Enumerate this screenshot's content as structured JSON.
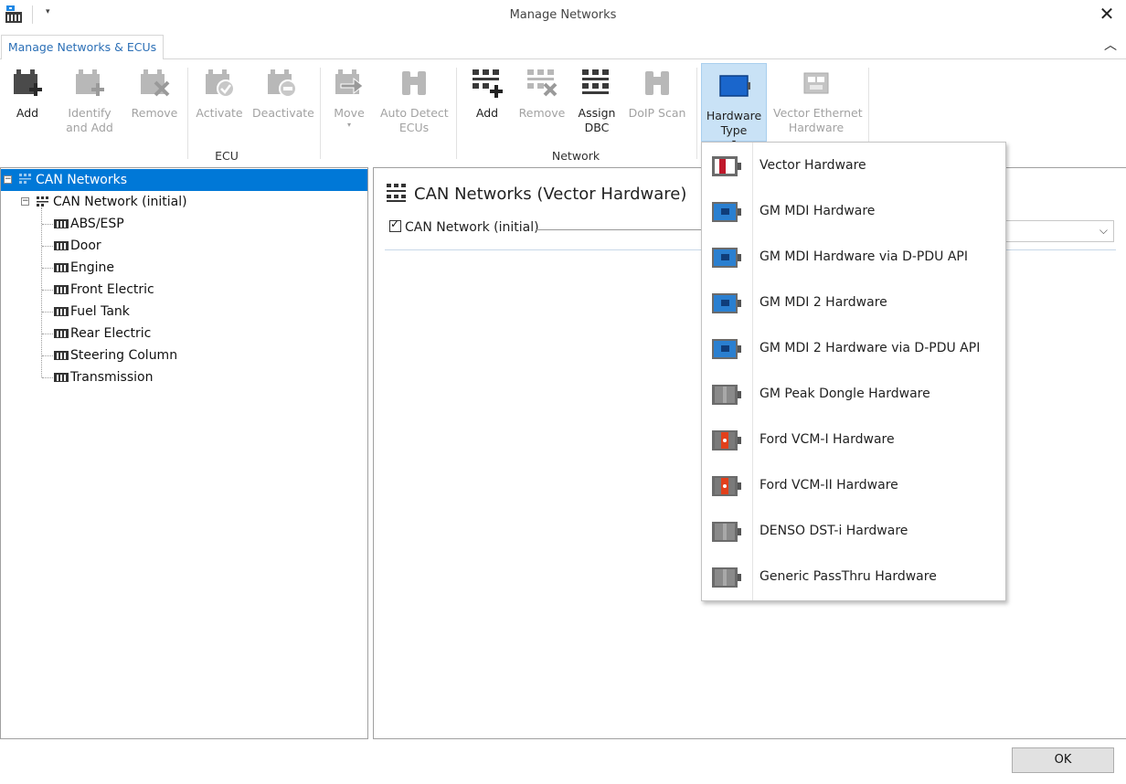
{
  "window": {
    "title": "Manage Networks",
    "close_glyph": "✕"
  },
  "ribbon_tab": {
    "label": "Manage Networks & ECUs"
  },
  "ribbon": {
    "ecu_group": {
      "label": "ECU",
      "add": "Add",
      "identify_line1": "Identify",
      "identify_line2": "and Add",
      "remove": "Remove",
      "activate": "Activate",
      "deactivate": "Deactivate",
      "move": "Move",
      "auto_detect_line1": "Auto Detect",
      "auto_detect_line2": "ECUs"
    },
    "network_group": {
      "label": "Network",
      "add": "Add",
      "remove": "Remove",
      "assign_line1": "Assign",
      "assign_line2": "DBC",
      "doip_scan": "DoIP Scan"
    },
    "hardware": {
      "type_line1": "Hardware",
      "type_line2": "Type",
      "vector_eth_line1": "Vector Ethernet",
      "vector_eth_line2": "Hardware"
    }
  },
  "tree": {
    "root": "CAN Networks",
    "network": "CAN Network (initial)",
    "ecus": [
      "ABS/ESP",
      "Door",
      "Engine",
      "Front Electric",
      "Fuel Tank",
      "Rear Electric",
      "Steering Column",
      "Transmission"
    ]
  },
  "content": {
    "title": "CAN Networks (Vector Hardware)",
    "network_checkbox_label": "CAN Network (initial)"
  },
  "hardware_menu": [
    {
      "label": "Vector Hardware",
      "icon": "vector-hardware-icon",
      "color": "#c0182b"
    },
    {
      "label": "GM MDI Hardware",
      "icon": "gm-mdi-icon",
      "color": "#2a7fd0"
    },
    {
      "label": "GM MDI Hardware via D-PDU API",
      "icon": "gm-mdi-icon",
      "color": "#2a7fd0"
    },
    {
      "label": "GM MDI 2 Hardware",
      "icon": "gm-mdi-icon",
      "color": "#2a7fd0"
    },
    {
      "label": "GM MDI 2 Hardware via D-PDU API",
      "icon": "gm-mdi-icon",
      "color": "#2a7fd0"
    },
    {
      "label": "GM Peak Dongle Hardware",
      "icon": "generic-dongle-icon",
      "color": "#8a8a8a"
    },
    {
      "label": "Ford VCM-I Hardware",
      "icon": "ford-vcm-icon",
      "color": "#e2401b"
    },
    {
      "label": "Ford VCM-II Hardware",
      "icon": "ford-vcm-icon",
      "color": "#e2401b"
    },
    {
      "label": "DENSO DST-i Hardware",
      "icon": "generic-dongle-icon",
      "color": "#8a8a8a"
    },
    {
      "label": "Generic PassThru Hardware",
      "icon": "generic-dongle-icon",
      "color": "#8a8a8a"
    }
  ],
  "footer": {
    "ok": "OK"
  },
  "colors": {
    "accent": "#0078d7",
    "tab_text": "#2b6fb6",
    "selected_ribbon": "#c9e2f6"
  }
}
